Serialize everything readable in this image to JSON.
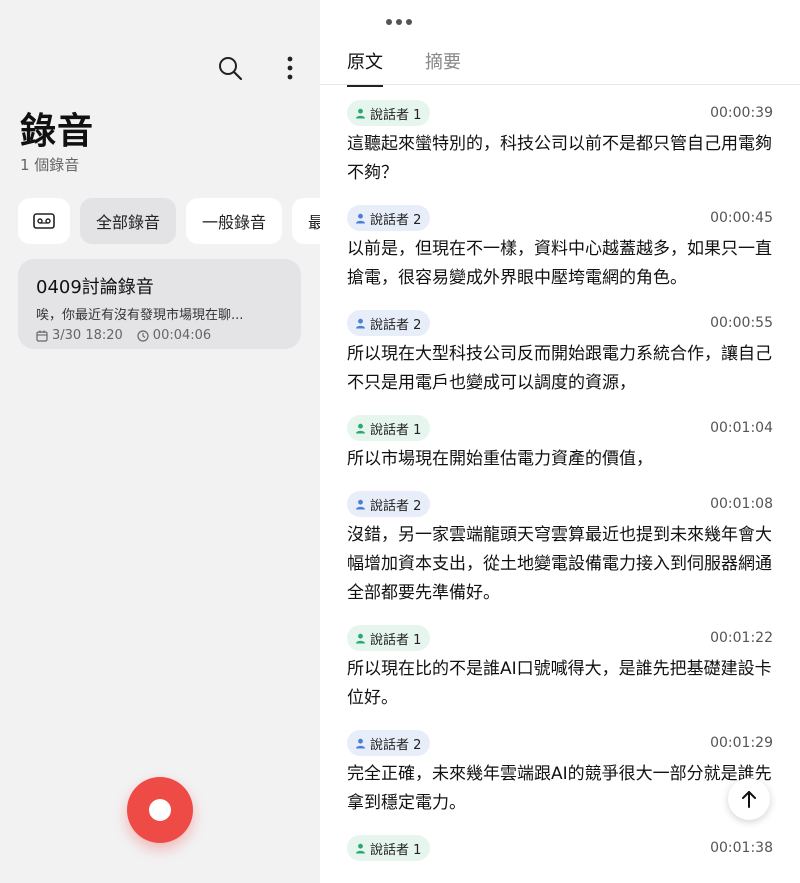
{
  "left": {
    "title": "錄音",
    "count": "1 個錄音",
    "icons": {
      "search": "search-icon",
      "more": "more-vert-icon"
    },
    "filters": [
      "全部錄音",
      "一般錄音",
      "最"
    ],
    "recording": {
      "title": "0409討論錄音",
      "preview": "唉，你最近有沒有發現市場現在聊...",
      "date": "3/30 18:20",
      "duration": "00:04:06"
    }
  },
  "right": {
    "tabs": [
      "原文",
      "摘要"
    ],
    "active_tab": "原文",
    "colors": {
      "speaker1_bg": "#e7f5ef",
      "speaker1_icon": "#2aa871",
      "speaker2_bg": "#e8eef9",
      "speaker2_icon": "#4a7fd6",
      "record": "#ee4a46"
    },
    "entries": [
      {
        "speaker": "說話者 1",
        "time": "00:00:39",
        "text": "這聽起來蠻特別的，科技公司以前不是都只管自己用電夠不夠？"
      },
      {
        "speaker": "說話者 2",
        "time": "00:00:45",
        "text": "以前是，但現在不一樣，資料中心越蓋越多，如果只一直搶電，很容易變成外界眼中壓垮電網的角色。"
      },
      {
        "speaker": "說話者 2",
        "time": "00:00:55",
        "text": "所以現在大型科技公司反而開始跟電力系統合作，讓自己不只是用電戶也變成可以調度的資源，"
      },
      {
        "speaker": "說話者 1",
        "time": "00:01:04",
        "text": "所以市場現在開始重估電力資產的價值，"
      },
      {
        "speaker": "說話者 2",
        "time": "00:01:08",
        "text": "沒錯，另一家雲端龍頭天穹雲算最近也提到未來幾年會大幅增加資本支出，從土地變電設備電力接入到伺服器網通全部都要先準備好。"
      },
      {
        "speaker": "說話者 1",
        "time": "00:01:22",
        "text": "所以現在比的不是誰AI口號喊得大，是誰先把基礎建設卡位好。"
      },
      {
        "speaker": "說話者 2",
        "time": "00:01:29",
        "text": "完全正確，未來幾年雲端跟AI的競爭很大一部分就是誰先拿到穩定電力。"
      },
      {
        "speaker": "說話者 1",
        "time": "00:01:38",
        "text": ""
      }
    ]
  }
}
